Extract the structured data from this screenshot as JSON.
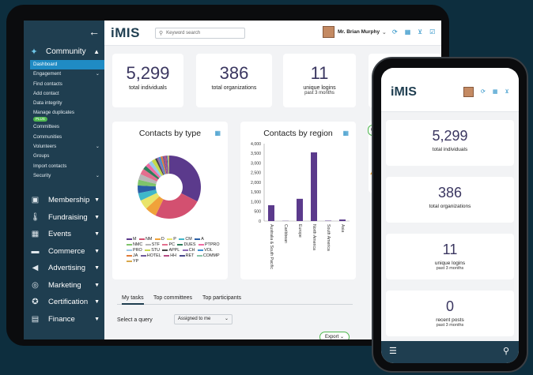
{
  "brand": "iMIS",
  "header": {
    "search_placeholder": "Keyword search",
    "user_name": "Mr. Brian Murphy"
  },
  "sidebar": {
    "community": {
      "label": "Community",
      "items": [
        {
          "label": "Dashboard"
        },
        {
          "label": "Engagement"
        },
        {
          "label": "Find contacts"
        },
        {
          "label": "Add contact"
        },
        {
          "label": "Data integrity"
        },
        {
          "label": "Manage duplicates",
          "badge": "PLUS"
        },
        {
          "label": "Committees"
        },
        {
          "label": "Communities"
        },
        {
          "label": "Volunteers"
        },
        {
          "label": "Groups"
        },
        {
          "label": "Import contacts"
        },
        {
          "label": "Security"
        }
      ]
    },
    "main": [
      {
        "label": "Membership",
        "icon": "id-card-icon"
      },
      {
        "label": "Fundraising",
        "icon": "thermometer-icon"
      },
      {
        "label": "Events",
        "icon": "calendar-icon"
      },
      {
        "label": "Commerce",
        "icon": "store-icon"
      },
      {
        "label": "Advertising",
        "icon": "megaphone-icon"
      },
      {
        "label": "Marketing",
        "icon": "target-icon"
      },
      {
        "label": "Certification",
        "icon": "ribbon-icon"
      },
      {
        "label": "Finance",
        "icon": "ledger-icon"
      }
    ]
  },
  "stats": {
    "individuals": {
      "value": "5,299",
      "label": "total individuals"
    },
    "organizations": {
      "value": "386",
      "label": "total organizations"
    },
    "logins": {
      "value": "11",
      "label": "unique logins",
      "sub": "past 3 months"
    }
  },
  "charts": {
    "type_title": "Contacts by type",
    "region_title": "Contacts by region"
  },
  "chart_data": [
    {
      "type": "pie",
      "title": "Contacts by type",
      "labels": [
        "M",
        "NM",
        "D",
        "P",
        "CM",
        "A",
        "NMC",
        "STF",
        "PC",
        "DUES",
        "PTPRO",
        "PRO",
        "STU",
        "APPL",
        "CH",
        "VOL",
        "JA",
        "HOTEL",
        "HH",
        "RET",
        "COMMP",
        "YP"
      ],
      "values": [
        33,
        25,
        6,
        5,
        4,
        4,
        3,
        3,
        3,
        2,
        2,
        2,
        2,
        1,
        1,
        1,
        1,
        1,
        1,
        0.5,
        0.5,
        0.5
      ],
      "colors": [
        "#5b3a8c",
        "#d35070",
        "#f0a23a",
        "#e9e46a",
        "#40b7c9",
        "#2a5ea6",
        "#7fc46b",
        "#b7b7b7",
        "#e36f8f",
        "#2f7d5b",
        "#f06ba3",
        "#9bc7e6",
        "#c6d84a",
        "#444444",
        "#8e6bb5",
        "#3d8fd1",
        "#e07b39",
        "#6e5a9a",
        "#b64b84",
        "#4a4a8c",
        "#8bc4a8",
        "#d8a84c"
      ]
    },
    {
      "type": "bar",
      "title": "Contacts by region",
      "categories": [
        "Australia & South Pacific",
        "Caribbean",
        "Europe",
        "North America",
        "South America",
        "Asia"
      ],
      "values": [
        820,
        10,
        1150,
        3550,
        20,
        80
      ],
      "ylim": [
        0,
        4000
      ],
      "yticks": [
        "0",
        "500",
        "1,000",
        "1,500",
        "2,000",
        "2,500",
        "3,000",
        "3,500",
        "4,000"
      ],
      "color": "#5b3a8c"
    }
  ],
  "tabs": [
    {
      "label": "My tasks",
      "active": true
    },
    {
      "label": "Top committees",
      "active": false
    },
    {
      "label": "Top participants",
      "active": false
    }
  ],
  "query": {
    "label": "Select a query",
    "selected": "Assigned to me"
  },
  "export_label": "Export",
  "phone": {
    "cards": [
      {
        "value": "5,299",
        "label": "total individuals",
        "sub": ""
      },
      {
        "value": "386",
        "label": "total organizations",
        "sub": ""
      },
      {
        "value": "11",
        "label": "unique logins",
        "sub": "past 3 months"
      },
      {
        "value": "0",
        "label": "recent posts",
        "sub": "past 3 months"
      }
    ]
  }
}
